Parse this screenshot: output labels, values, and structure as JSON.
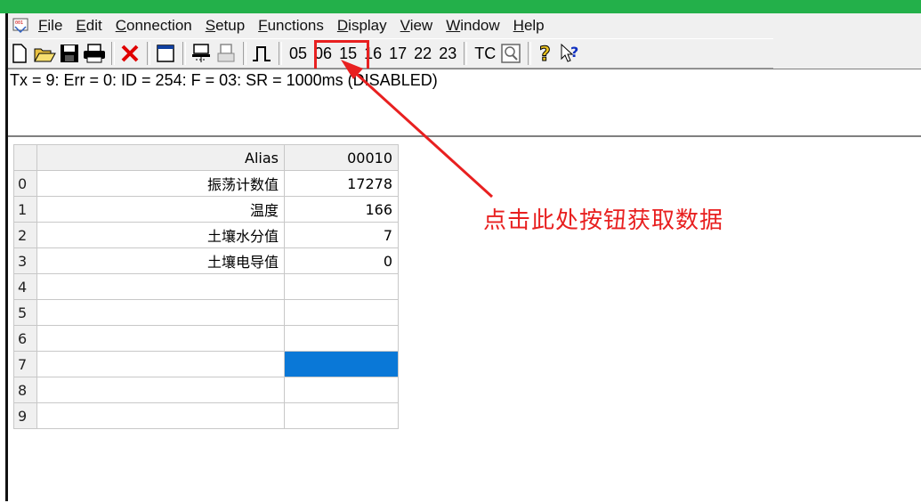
{
  "window": {
    "title_bar_color": "#23b04a"
  },
  "menu": {
    "items": [
      {
        "label": "File",
        "mnemonic": "F",
        "rest": "ile"
      },
      {
        "label": "Edit",
        "mnemonic": "E",
        "rest": "dit"
      },
      {
        "label": "Connection",
        "mnemonic": "C",
        "rest": "onnection"
      },
      {
        "label": "Setup",
        "mnemonic": "S",
        "rest": "etup"
      },
      {
        "label": "Functions",
        "mnemonic": "F",
        "rest": "unctions"
      },
      {
        "label": "Display",
        "mnemonic": "D",
        "rest": "isplay"
      },
      {
        "label": "View",
        "mnemonic": "V",
        "rest": "iew"
      },
      {
        "label": "Window",
        "mnemonic": "W",
        "rest": "indow"
      },
      {
        "label": "Help",
        "mnemonic": "H",
        "rest": "elp"
      }
    ]
  },
  "toolbar": {
    "icons": [
      "new-icon",
      "open-icon",
      "save-icon",
      "print-icon",
      "delete-icon",
      "window-icon",
      "connect-icon",
      "disconnect-icon",
      "read-once-icon"
    ],
    "function_codes": [
      "05",
      "06",
      "15",
      "16",
      "17",
      "22",
      "23"
    ],
    "tc_label": "TC",
    "help_icon": "help-icon",
    "context_help_icon": "context-help-icon"
  },
  "status": {
    "text": "Tx = 9: Err = 0: ID = 254: F = 03: SR = 1000ms  (DISABLED)"
  },
  "grid": {
    "header_alias": "Alias",
    "header_value": "00010",
    "rows": [
      {
        "index": "0",
        "alias": "振荡计数值",
        "value": "17278"
      },
      {
        "index": "1",
        "alias": "温度",
        "value": "166"
      },
      {
        "index": "2",
        "alias": "土壤水分值",
        "value": "7"
      },
      {
        "index": "3",
        "alias": "土壤电导值",
        "value": "0"
      },
      {
        "index": "4",
        "alias": "",
        "value": ""
      },
      {
        "index": "5",
        "alias": "",
        "value": ""
      },
      {
        "index": "6",
        "alias": "",
        "value": ""
      },
      {
        "index": "7",
        "alias": "",
        "value": ""
      },
      {
        "index": "8",
        "alias": "",
        "value": ""
      },
      {
        "index": "9",
        "alias": "",
        "value": ""
      }
    ],
    "selected_row": 7,
    "selected_color": "#0a78d7"
  },
  "annotation": {
    "text": "点击此处按钮获取数据",
    "color": "#e82020"
  }
}
